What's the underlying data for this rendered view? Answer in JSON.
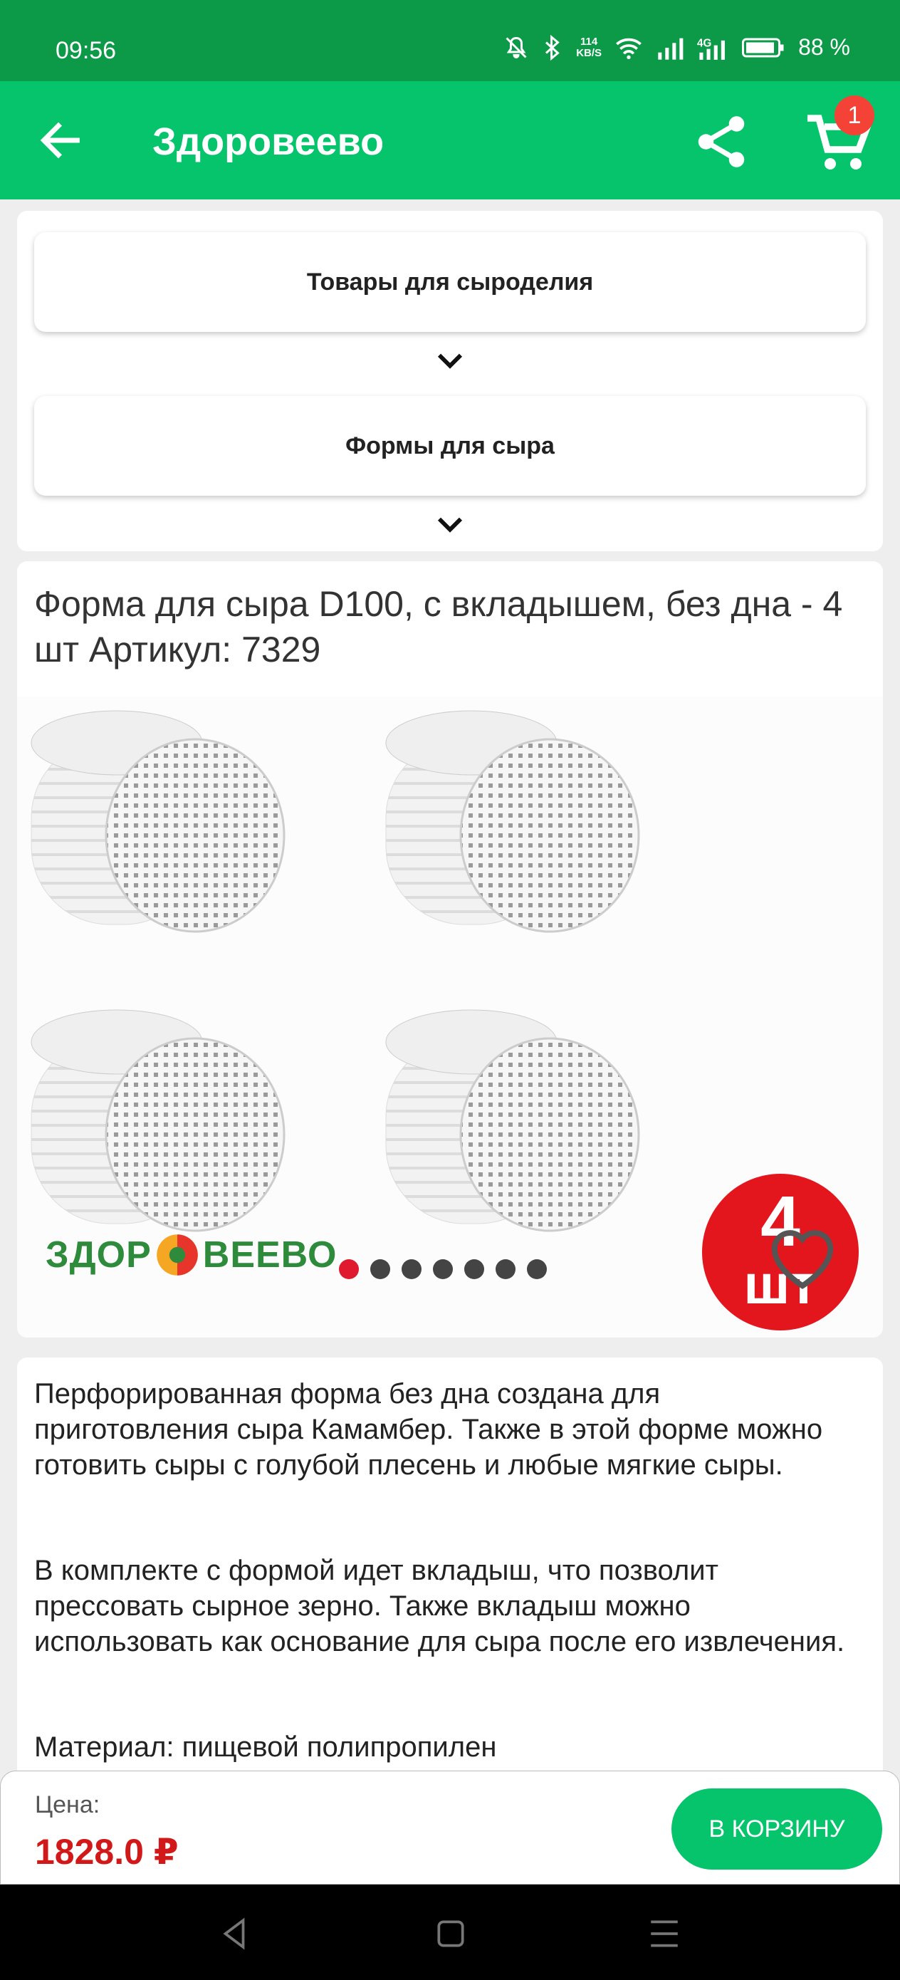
{
  "status_bar": {
    "time": "09:56",
    "net_speed_value": "114",
    "net_speed_unit": "KB/S",
    "battery": "88 %"
  },
  "app_bar": {
    "title": "Здоровеево",
    "cart_count": "1"
  },
  "categories": [
    {
      "label": "Товары для сыроделия"
    },
    {
      "label": "Формы для сыра"
    }
  ],
  "product": {
    "title": "Форма для сыра D100, с вкладышем, без дна - 4 шт Артикул: 7329",
    "brand_logo": "ЗДОРОВЕЕВО",
    "quantity_badge_num": "4",
    "quantity_badge_unit": "шт",
    "image_count": 7,
    "active_image": 1
  },
  "description": {
    "paragraphs": [
      "Перфорированная форма без дна создана для приготовления сыра Камамбер. Также в этой форме можно готовить сыры с голубой плесень и любые мягкие сыры.",
      "В комплекте с формой идет вкладыш, что позволит прессовать сырное зерно. Также вкладыш можно использовать как основание для сыра после его извлечения.",
      "Материал: пищевой полипропилен"
    ]
  },
  "price": {
    "label": "Цена:",
    "value": "1828.0 ₽",
    "add_to_cart": "В КОРЗИНУ"
  },
  "colors": {
    "status_green": "#0d9a48",
    "app_green": "#05c46b",
    "price_red": "#d11919"
  }
}
